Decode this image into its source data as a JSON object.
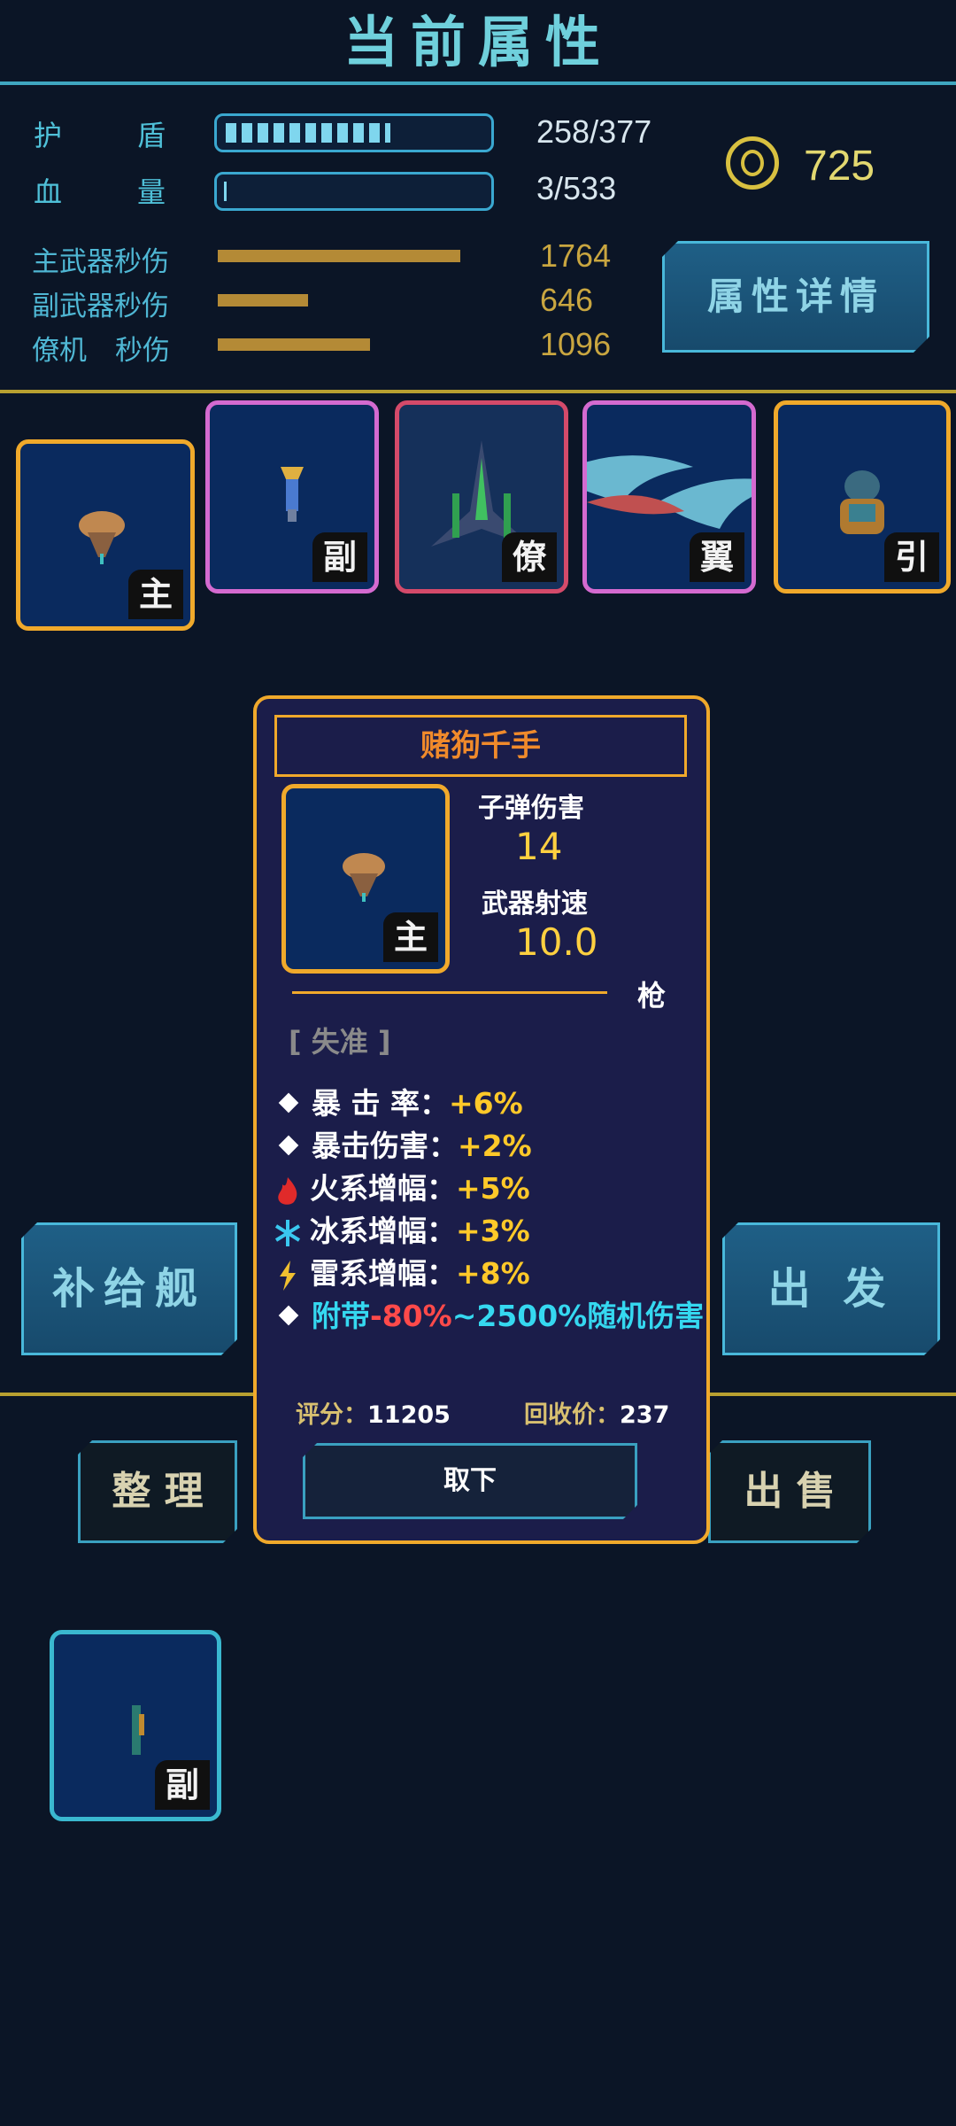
{
  "header": {
    "title": "当前属性"
  },
  "stats": {
    "shield": {
      "label_a": "护",
      "label_b": "盾",
      "value": "258/377",
      "fill": 0.68
    },
    "hp": {
      "label_a": "血",
      "label_b": "量",
      "value": "3/533",
      "fill": 0.006
    }
  },
  "coins": {
    "value": "725",
    "icon": "coin-icon"
  },
  "dps": [
    {
      "label": "主武器秒伤",
      "value": "1764",
      "fill": 1.0
    },
    {
      "label": "副武器秒伤",
      "value": "646",
      "fill": 0.37
    },
    {
      "label_a": "僚机",
      "label_b": "秒伤",
      "value": "1096",
      "fill": 0.62
    }
  ],
  "buttons": {
    "details": "属性详情",
    "supply": "补给舰",
    "depart": "出 发",
    "sort": "整 理",
    "sell": "出 售"
  },
  "equip_slots": [
    {
      "tag": "主",
      "border": "#f0a92b",
      "icon": "main-weapon-ship-icon"
    },
    {
      "tag": "副",
      "border": "#d46ad0",
      "icon": "sub-weapon-missile-icon"
    },
    {
      "tag": "僚",
      "border": "#d44a6a",
      "icon": "wingman-fighter-icon"
    },
    {
      "tag": "翼",
      "border": "#d46ad0",
      "icon": "wing-icon"
    },
    {
      "tag": "引",
      "border": "#f0a92b",
      "icon": "engine-icon"
    }
  ],
  "popup": {
    "name": "赌狗千手",
    "item_tag": "主",
    "bullet_damage_label": "子弹伤害",
    "bullet_damage": "14",
    "fire_rate_label": "武器射速",
    "fire_rate": "10.0",
    "weapon_type": "枪",
    "quality": "[ 失准 ]",
    "attributes": [
      {
        "icon": "diamond-icon",
        "label": "暴 击 率：",
        "value": "+6%"
      },
      {
        "icon": "diamond-icon",
        "label": "暴击伤害：",
        "value": "+2%"
      },
      {
        "icon": "fire-icon",
        "label": "火系增幅：",
        "value": "+5%"
      },
      {
        "icon": "ice-icon",
        "label": "冰系增幅：",
        "value": "+3%"
      },
      {
        "icon": "lightning-icon",
        "label": "雷系增幅：",
        "value": "+8%"
      }
    ],
    "special": {
      "prefix": "附带",
      "neg": "-80%",
      "suffix": "~2500%随机伤害"
    },
    "score_label": "评分：",
    "score": "11205",
    "recycle_label": "回收价：",
    "recycle": "237",
    "unequip": "取下"
  },
  "inventory": [
    {
      "tag": "副",
      "icon": "sub-weapon-icon"
    }
  ],
  "colors": {
    "accent": "#6fd0dc",
    "gold": "#f0a92b",
    "value_yellow": "#ffc929",
    "neg_red": "#ff4a4a",
    "special_cyan": "#35d8f0"
  }
}
